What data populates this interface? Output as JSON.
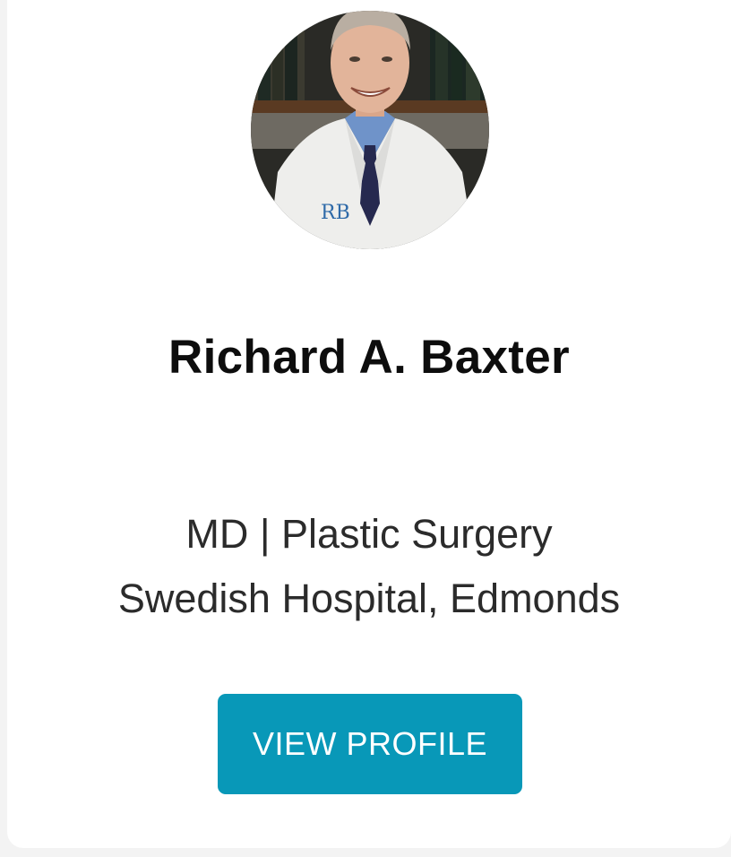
{
  "profile": {
    "name": "Richard A. Baxter",
    "credentials_line": "MD | Plastic Surgery",
    "location_line": "Swedish Hospital, Edmonds",
    "photo_icon": "doctor-portrait-photo"
  },
  "actions": {
    "view_profile_label": "VIEW PROFILE"
  },
  "colors": {
    "button_bg": "#0898b8",
    "button_text": "#ffffff",
    "name_text": "#0d0d0d",
    "body_text": "#2b2b2b"
  }
}
